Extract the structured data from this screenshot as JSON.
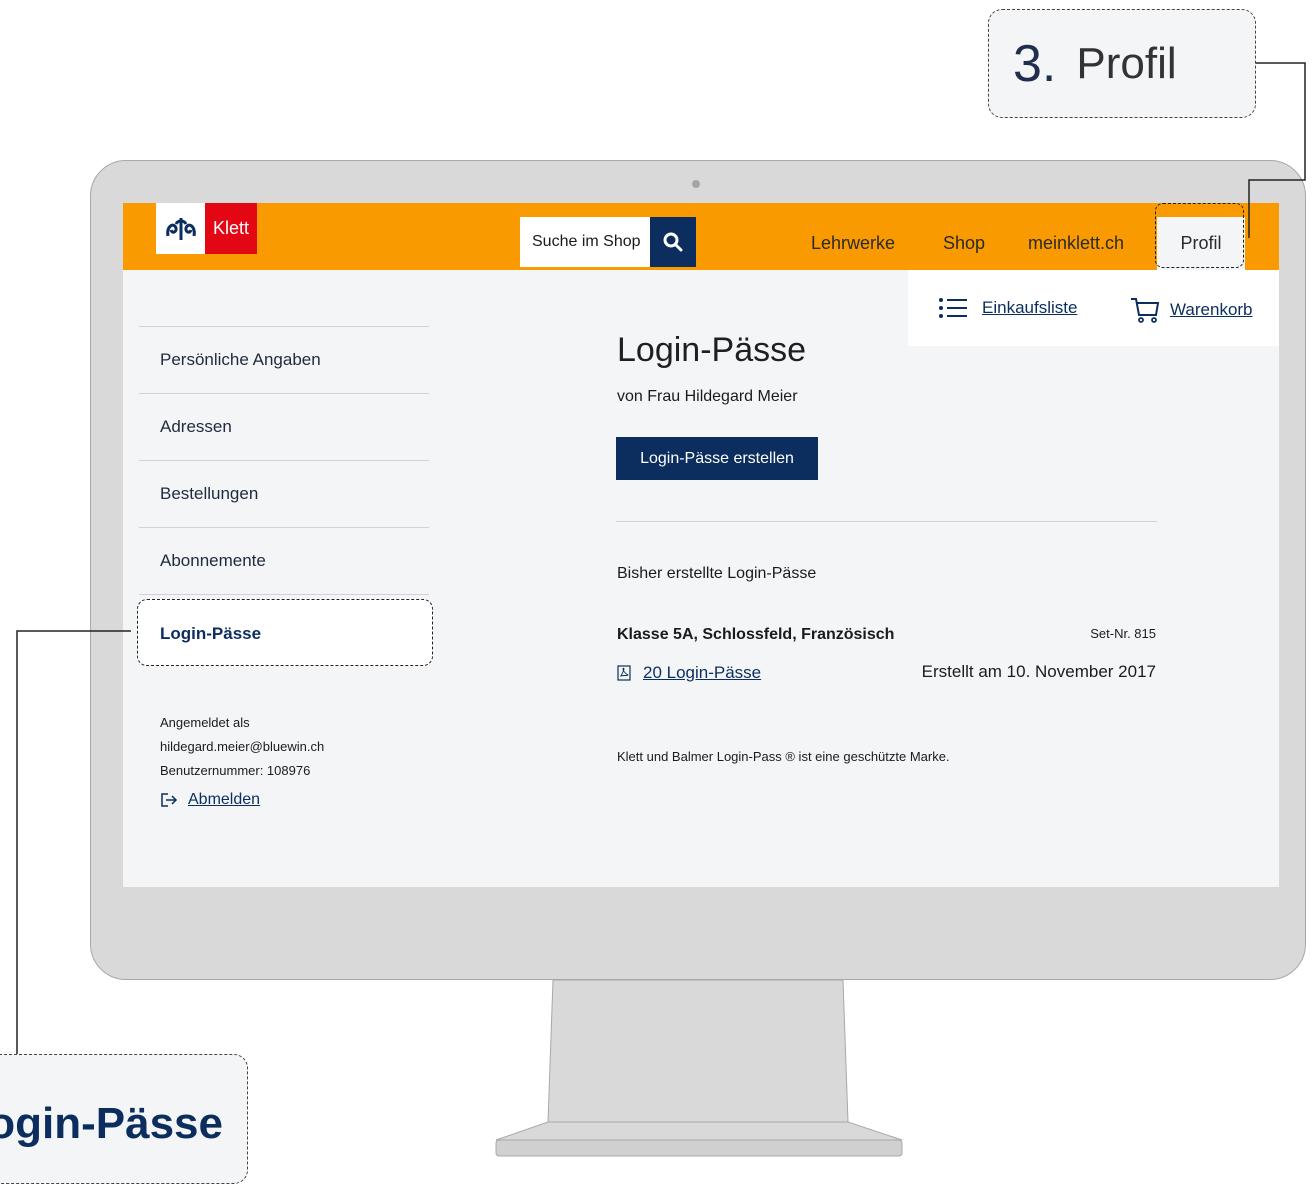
{
  "header": {
    "logo_text": "Klett",
    "search_placeholder": "Suche im Shop",
    "nav": [
      "Lehrwerke",
      "Shop",
      "meinklett.ch"
    ],
    "profile_label": "Profil"
  },
  "utility": {
    "shopping_list": "Einkaufsliste",
    "cart": "Warenkorb"
  },
  "sidebar": {
    "items": [
      "Persönliche Angaben",
      "Adressen",
      "Bestellungen",
      "Abonnemente",
      "Login-Pässe"
    ],
    "active_index": 4,
    "account": {
      "line1": "Angemeldet als",
      "email": "hildegard.meier@bluewin.ch",
      "user_number": "Benutzernummer: 108976"
    },
    "logout": "Abmelden"
  },
  "main": {
    "title": "Login-Pässe",
    "subtitle": "von Frau Hildegard Meier",
    "create_button": "Login-Pässe erstellen",
    "section_heading": "Bisher erstellte Login-Pässe",
    "set": {
      "name": "Klasse 5A, Schlossfeld, Französisch",
      "number": "Set-Nr. 815",
      "link": "20 Login-Pässe",
      "created": "Erstellt am 10. November 2017"
    },
    "trademark": "Klett und Balmer Login-Pass ® ist eine geschützte Marke."
  },
  "callouts": {
    "step_number": "3.",
    "step_label": "Profil",
    "zoom_label": "Login-Pässe"
  },
  "colors": {
    "header_orange": "#f99a00",
    "navy": "#0c2e5e",
    "logo_red": "#e30613"
  }
}
